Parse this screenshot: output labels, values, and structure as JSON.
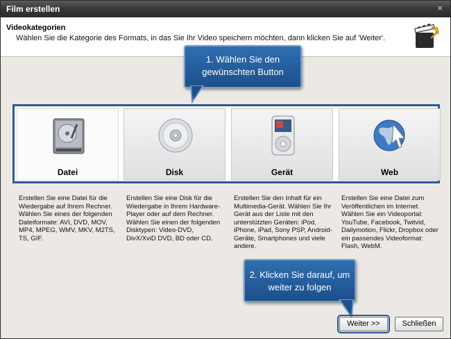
{
  "window": {
    "title": "Film erstellen",
    "close_glyph": "×"
  },
  "header": {
    "title": "Videokategorien",
    "subtitle": "Wählen Sie die Kategorie des Formats, in das Sie Ihr Video speichern möchten, dann klicken Sie auf 'Weiter'.",
    "icon": "video-clapper-arrow-icon"
  },
  "callouts": {
    "first": "1. Wählen Sie den gewünschten Button",
    "second": "2. Klicken Sie darauf, um weiter zu folgen"
  },
  "categories": [
    {
      "label": "Datei",
      "icon": "hard-disk-icon",
      "selected": true,
      "description": "Erstellen Sie eine Datei für die Wiedergabe auf Ihrem Rechner. Wählen Sie eines der folgenden Dateiformate:  AVI, DVD, MOV, MP4, MPEG, WMV, MKV, M2TS, TS, GIF."
    },
    {
      "label": "Disk",
      "icon": "disc-icon",
      "selected": false,
      "description": "Erstellen Sie eine Disk für die Wiedergabe in Ihrem Hardware-Player oder auf dem Rechner. Wählen Sie einen der folgenden Disktypen: Video-DVD, DivX/XviD DVD, BD oder CD."
    },
    {
      "label": "Gerät",
      "icon": "media-player-icon",
      "selected": false,
      "description": "Erstellen Sie den Inhalt für ein Multimedia-Gerät. Wählen Sie Ihr Gerät aus der Liste mit den unterstützten Geräten: iPod, iPhone, iPad, Sony PSP, Android-Geräte, Smartphones und viele andere."
    },
    {
      "label": "Web",
      "icon": "globe-icon",
      "selected": false,
      "description": "Erstellen Sie eine Datei zum Veröffentlichen im Internet. Wählen Sie ein Videoportal: YouTube, Facebook, Twitvid, Dailymotion, Flickr, Dropbox oder ein passendes Videoformat: Flash, WebM."
    }
  ],
  "buttons": {
    "next": "Weiter >>",
    "close": "Schließen"
  }
}
